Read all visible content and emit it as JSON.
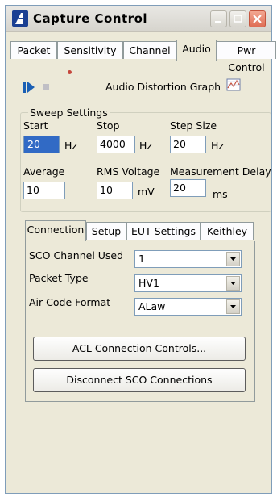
{
  "window": {
    "title": "Capture Control",
    "controls": {
      "minimize_icon": "minimize-icon",
      "maximize_icon": "maximize-icon",
      "close_icon": "close-icon"
    }
  },
  "main_tabs": [
    {
      "label": "Packet",
      "active": false
    },
    {
      "label": "Sensitivity",
      "active": false
    },
    {
      "label": "Channel",
      "active": false
    },
    {
      "label": "Audio",
      "active": true
    },
    {
      "label": "Pwr Control",
      "active": false
    }
  ],
  "toolbar": {
    "play_icon": "play-icon",
    "stop_icon": "stop-icon",
    "graph_label": "Audio Distortion Graph",
    "graph_icon": "graph-icon"
  },
  "sweep": {
    "title": "Sweep Settings",
    "start": {
      "label": "Start",
      "value": "20",
      "unit": "Hz"
    },
    "stop": {
      "label": "Stop",
      "value": "4000",
      "unit": "Hz"
    },
    "step": {
      "label": "Step Size",
      "value": "20",
      "unit": "Hz"
    },
    "average": {
      "label": "Average",
      "value": "10"
    },
    "rms": {
      "label": "RMS Voltage",
      "value": "10",
      "unit": "mV"
    },
    "delay": {
      "label": "Measurement Delay",
      "value": "20",
      "unit": "ms"
    }
  },
  "sub_tabs": [
    {
      "label": "Connection",
      "active": true
    },
    {
      "label": "Setup",
      "active": false
    },
    {
      "label": "EUT Settings",
      "active": false
    },
    {
      "label": "Keithley",
      "active": false
    }
  ],
  "connection": {
    "sco_channel": {
      "label": "SCO Channel Used",
      "value": "1"
    },
    "packet_type": {
      "label": "Packet Type",
      "value": "HV1"
    },
    "air_code": {
      "label": "Air Code Format",
      "value": "ALaw"
    },
    "acl_button": "ACL Connection Controls...",
    "disconnect_button": "Disconnect SCO Connections"
  },
  "colors": {
    "window_bg": "#ece9d8",
    "selection": "#316ac5",
    "close_button": "#df6d55"
  }
}
